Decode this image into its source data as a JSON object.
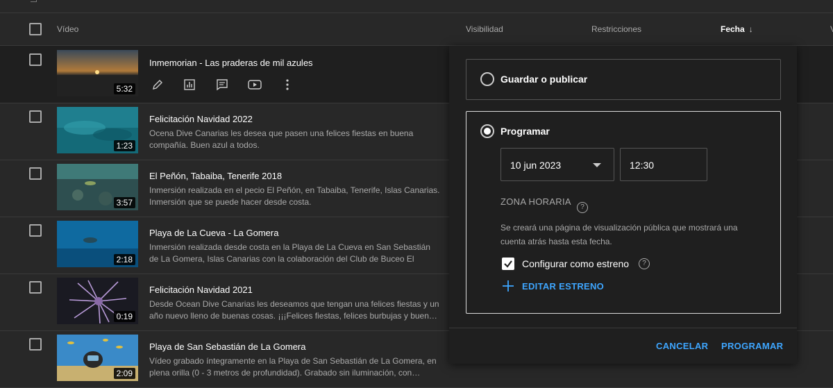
{
  "table": {
    "headers": {
      "video": "Vídeo",
      "visibility": "Visibilidad",
      "restrictions": "Restricciones",
      "date": "Fecha",
      "date_sort_icon": "arrow-down-icon",
      "cut": "V"
    },
    "rows": [
      {
        "title": "Inmemorian - Las praderas de mil azules",
        "description": "",
        "duration": "5:32"
      },
      {
        "title": "Felicitación Navidad 2022",
        "description": "Ocena Dive Canarias les desea que pasen una felices fiestas en buena compañía. Buen azul a todos.",
        "duration": "1:23"
      },
      {
        "title": "El Peñón, Tabaiba, Tenerife 2018",
        "description": "Inmersión realizada en el pecio El Peñón, en Tabaiba, Tenerife, Islas Canarias. Inmersión que se puede hacer desde costa.",
        "duration": "3:57"
      },
      {
        "title": "Playa de La Cueva - La Gomera",
        "description": "Inmersión realizada desde costa en la Playa de La Cueva en San Sebastián de La Gomera, Islas Canarias con la colaboración del Club de Buceo El Sebadal.",
        "duration": "2:18"
      },
      {
        "title": "Felicitación Navidad 2021",
        "description": "Desde Ocean Dive Canarias les deseamos que tengan una felices fiestas y un año nuevo lleno de buenas cosas. ¡¡¡Felices fiestas, felices burbujas y buen…",
        "duration": "0:19"
      },
      {
        "title": "Playa de San Sebastián de La Gomera",
        "description": "Vídeo grabado íntegramente en la Playa de San Sebastián de La Gomera, en plena orilla (0 - 3 metros de profundidad). Grabado sin iluminación, con…",
        "duration": "2:09"
      }
    ],
    "row_actions": [
      "pencil-icon",
      "analytics-icon",
      "comments-icon",
      "youtube-icon",
      "more-vert-icon"
    ]
  },
  "dialog": {
    "option_save": "Guardar o publicar",
    "option_schedule": "Programar",
    "date_value": "10 jun 2023",
    "time_value": "12:30",
    "timezone_label": "ZONA HORARIA",
    "note": "Se creará una página de visualización pública que mostrará una cuenta atrás hasta esta fecha.",
    "premiere_label": "Configurar como estreno",
    "premiere_checked": true,
    "edit_premiere": "EDITAR ESTRENO",
    "cancel": "CANCELAR",
    "schedule": "PROGRAMAR"
  },
  "colors": {
    "accent": "#3ea6ff",
    "background": "#282828",
    "dialog": "#1f1f1f"
  }
}
